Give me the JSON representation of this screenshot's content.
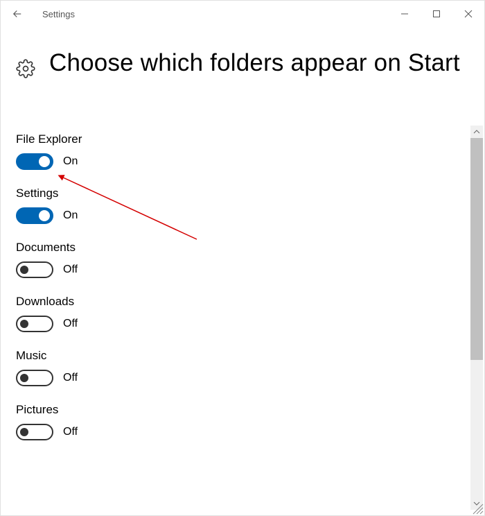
{
  "titlebar": {
    "title": "Settings"
  },
  "page": {
    "title": "Choose which folders appear on Start"
  },
  "toggles": [
    {
      "label": "File Explorer",
      "state": "On",
      "on": true
    },
    {
      "label": "Settings",
      "state": "On",
      "on": true
    },
    {
      "label": "Documents",
      "state": "Off",
      "on": false
    },
    {
      "label": "Downloads",
      "state": "Off",
      "on": false
    },
    {
      "label": "Music",
      "state": "Off",
      "on": false
    },
    {
      "label": "Pictures",
      "state": "Off",
      "on": false
    }
  ]
}
